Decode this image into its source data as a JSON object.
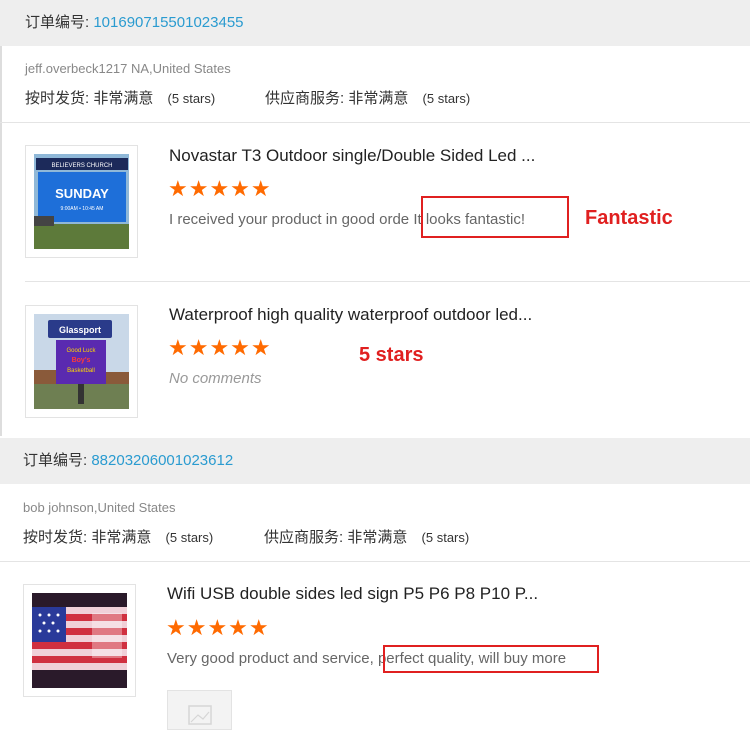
{
  "orders": [
    {
      "order_label": "订单编号:",
      "order_number": "101690715501023455",
      "buyer": "jeff.overbeck1217 NA,United States",
      "ship_label": "按时发货:",
      "ship_value": "非常满意",
      "ship_stars": "(5 stars)",
      "service_label": "供应商服务:",
      "service_value": "非常满意",
      "service_stars": "(5 stars)",
      "items": [
        {
          "title": "Novastar T3 Outdoor single/Double Sided Led ...",
          "stars": "★★★★★",
          "comment_a": "I received your product in good orde",
          "comment_b": "It looks fantastic!",
          "annotation": "Fantastic",
          "sign_text": "SUNDAY",
          "sign_sub": "9:00AM • 10:45 AM",
          "sign_header": "BELIEVERS CHURCH"
        },
        {
          "title": "Waterproof high quality waterproof outdoor led...",
          "stars": "★★★★★",
          "no_comment": "No comments",
          "annotation": "5 stars",
          "sign_top": "Glassport",
          "sign_line1": "Good Luck",
          "sign_line2": "Boy's",
          "sign_line3": "Basketball"
        }
      ]
    },
    {
      "order_label": "订单编号:",
      "order_number": "88203206001023612",
      "buyer": "bob johnson,United States",
      "ship_label": "按时发货:",
      "ship_value": "非常满意",
      "ship_stars": "(5 stars)",
      "service_label": "供应商服务:",
      "service_value": "非常满意",
      "service_stars": "(5 stars)",
      "items": [
        {
          "title": "Wifi USB double sides led sign P5 P6 P8 P10 P...",
          "stars": "★★★★★",
          "comment_a": "Very good product and service,",
          "comment_b": "perfect quality, will buy more"
        }
      ]
    }
  ],
  "colors": {
    "accent_link": "#2a9bd0",
    "star": "#ff6a00",
    "annotation": "#e02020",
    "header_bg": "#eeeeee"
  }
}
